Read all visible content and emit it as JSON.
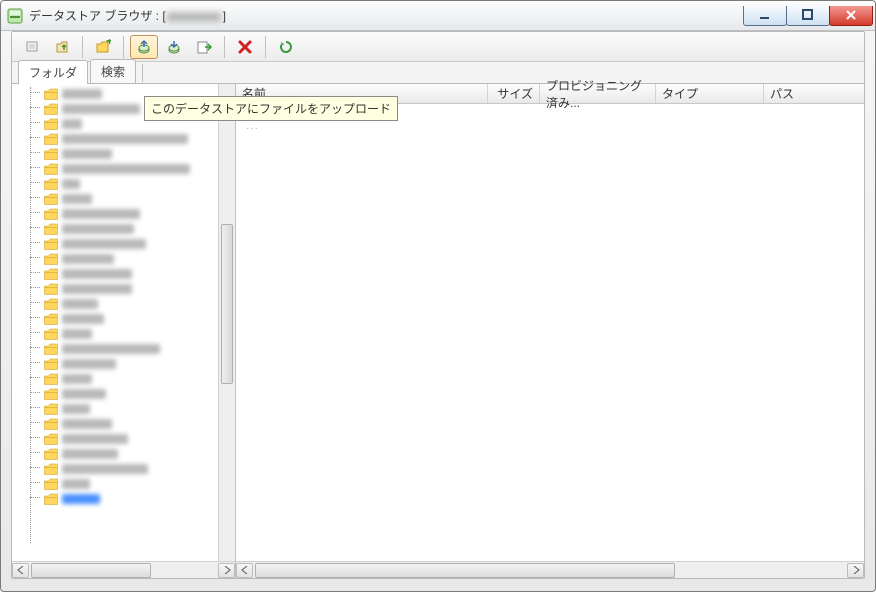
{
  "window": {
    "title_prefix": "データストア ブラウザ : [",
    "title_suffix": "]"
  },
  "toolbar": {
    "tooltip_upload": "このデータストアにファイルをアップロード"
  },
  "tabs": {
    "folders": "フォルダ",
    "search": "検索"
  },
  "columns": {
    "name": "名前",
    "size": "サイズ",
    "provisioned": "プロビジョニング済み...",
    "type": "タイプ",
    "path": "パス"
  },
  "tree": {
    "items": [
      {
        "w": 40
      },
      {
        "w": 78
      },
      {
        "w": 20
      },
      {
        "w": 126
      },
      {
        "w": 50
      },
      {
        "w": 128
      },
      {
        "w": 18
      },
      {
        "w": 30
      },
      {
        "w": 78
      },
      {
        "w": 72
      },
      {
        "w": 84
      },
      {
        "w": 52
      },
      {
        "w": 70
      },
      {
        "w": 70
      },
      {
        "w": 36
      },
      {
        "w": 42
      },
      {
        "w": 30
      },
      {
        "w": 98
      },
      {
        "w": 54
      },
      {
        "w": 30
      },
      {
        "w": 44
      },
      {
        "w": 28
      },
      {
        "w": 50
      },
      {
        "w": 66
      },
      {
        "w": 56
      },
      {
        "w": 86
      },
      {
        "w": 28
      },
      {
        "w": 38,
        "selected": true
      }
    ]
  },
  "empty_mark": "..."
}
